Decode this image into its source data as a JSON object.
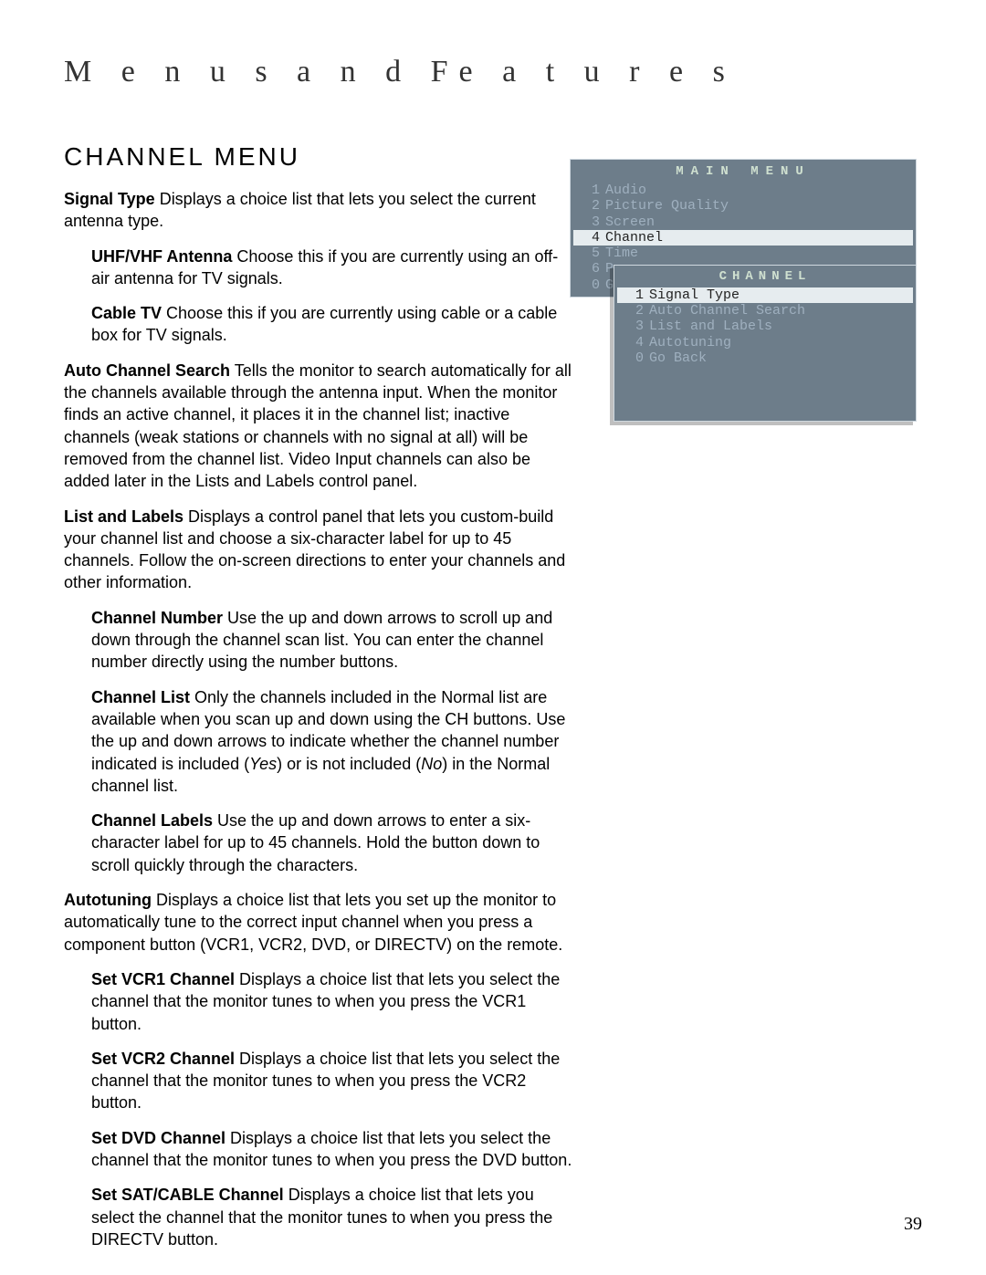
{
  "chapter_heading": "M e n u s  a n d  Fe a t u r e s",
  "section_heading": "CHANNEL MENU",
  "page_number": "39",
  "paragraphs": {
    "signal_type": {
      "label": "Signal Type",
      "text": "  Displays a choice list that lets you select the current antenna type."
    },
    "uhf_vhf": {
      "label": "UHF/VHF Antenna",
      "text": "  Choose this if you are currently using an off-air antenna for TV signals."
    },
    "cable_tv": {
      "label": "Cable TV",
      "text": "  Choose this if you are currently using cable or a cable box for TV signals."
    },
    "auto_search": {
      "label": "Auto Channel Search",
      "text": "  Tells the monitor to search automatically for all the channels available through the antenna input. When the monitor finds an active channel, it places it in the channel list; inactive channels (weak stations or channels with no signal at all) will be removed from the channel list. Video Input channels can also be added later in the Lists and Labels control panel."
    },
    "list_labels": {
      "label": "List and Labels",
      "text": "  Displays a control panel that lets you custom-build your channel list and choose a six-character label for up to 45 channels. Follow the on-screen directions to enter your channels and other information."
    },
    "chan_number": {
      "label": "Channel Number",
      "text": "  Use the up and down arrows to scroll up and down through the channel scan list. You can enter the channel number directly using the number buttons."
    },
    "chan_list": {
      "label": "Channel List",
      "pre": "  Only the channels included in the Normal list are available when you scan up and down using the CH buttons. Use the up and down arrows to indicate whether the channel number indicated is included (",
      "yes": "Yes",
      "mid": ") or is not included (",
      "no": "No",
      "post": ") in the Normal channel list."
    },
    "chan_labels": {
      "label": "Channel Labels",
      "text": "  Use the up and down arrows to enter a six-character label for up to 45 channels. Hold the button down to scroll quickly through the characters."
    },
    "autotuning": {
      "label": "Autotuning",
      "text": "  Displays a choice list that lets you set up the monitor to automatically tune to the correct input channel when you press a component button (VCR1, VCR2, DVD, or DIRECTV) on the remote."
    },
    "set_vcr1": {
      "label": "Set VCR1 Channel",
      "text": "  Displays a choice list that lets you select the channel that the monitor tunes to when you press the VCR1 button."
    },
    "set_vcr2": {
      "label": "Set VCR2 Channel",
      "text": "  Displays a choice list that lets you select the channel that the monitor tunes to when you press the VCR2 button."
    },
    "set_dvd": {
      "label": "Set DVD Channel",
      "text": "  Displays a choice list that lets you select the channel that the monitor tunes to when you press the DVD button."
    },
    "set_sat": {
      "label": "Set SAT/CABLE Channel",
      "text": "  Displays a choice list that lets you select the channel that the monitor tunes to when you press the DIRECTV button."
    }
  },
  "osd": {
    "main_title": "MAIN MENU",
    "main_items": [
      {
        "num": "1",
        "label": "Audio"
      },
      {
        "num": "2",
        "label": "Picture Quality"
      },
      {
        "num": "3",
        "label": "Screen"
      },
      {
        "num": "4",
        "label": "Channel"
      },
      {
        "num": "5",
        "label": "Time"
      },
      {
        "num": "6",
        "label": "P"
      },
      {
        "num": "0",
        "label": "Go"
      }
    ],
    "main_selected_index": 3,
    "channel_title": "CHANNEL",
    "channel_items": [
      {
        "num": "1",
        "label": "Signal Type"
      },
      {
        "num": "2",
        "label": "Auto Channel Search"
      },
      {
        "num": "3",
        "label": "List and Labels"
      },
      {
        "num": "4",
        "label": "Autotuning"
      },
      {
        "num": "0",
        "label": "Go Back"
      }
    ],
    "channel_selected_index": 0
  }
}
